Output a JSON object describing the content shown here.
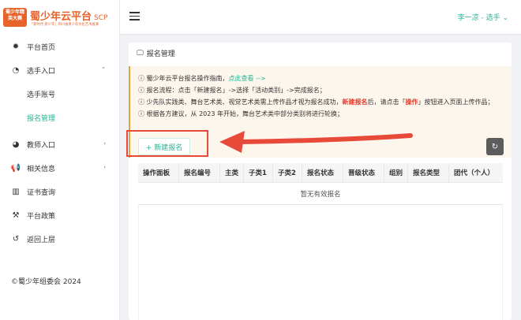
{
  "brand": {
    "badge": "蜀少年精英大赛",
    "title": "蜀少年云平台",
    "suffix": "SCP",
    "subtitle": "「新时代·新少年」四川省青少年文化艺术展演",
    "color": "#e8632a"
  },
  "sidebar": {
    "items": [
      {
        "label": "平台首页",
        "icon": "gear-icon"
      },
      {
        "label": "选手入口",
        "icon": "user-icon",
        "expanded": true
      },
      {
        "label": "教师入口",
        "icon": "teacher-icon"
      },
      {
        "label": "相关信息",
        "icon": "megaphone-icon"
      },
      {
        "label": "证书查询",
        "icon": "certificate-icon"
      },
      {
        "label": "平台政策",
        "icon": "hammer-icon"
      },
      {
        "label": "返回上层",
        "icon": "back-icon"
      }
    ],
    "sub_items": [
      {
        "label": "选手账号"
      },
      {
        "label": "报名管理",
        "active": true
      }
    ],
    "copyright": "©蜀少年组委会 2024"
  },
  "header": {
    "user": "李一凉 - 选手 ⌄"
  },
  "card": {
    "title": "报名管理",
    "notice": {
      "line1_text": "蜀少年云平台报名操作指南，",
      "line1_link": "点此查看 -->",
      "line2": "报名流程：点击「新建报名」->选择「活动类别」->完成报名；",
      "line3_a": "少先队实践类、舞台艺术类、视觉艺术类需上传作品才视为报名成功，",
      "line3_red1": "新建报名",
      "line3_b": "后，请点击「",
      "line3_red2": "操作",
      "line3_c": "」按钮进入页面上传作品；",
      "line4": "根据各方建议，从 2023 年开始，舞台艺术类中部分类别将进行轮换；"
    },
    "new_button": "+ 新建报名",
    "table": {
      "columns": [
        "操作面板",
        "报名编号",
        "主类",
        "子类1",
        "子类2",
        "报名状态",
        "晋级状态",
        "组别",
        "报名类型",
        "团代（个人）"
      ],
      "empty_text": "暂无有效报名"
    }
  },
  "colors": {
    "accent": "#29b396",
    "notice_bg": "#fdf6ec",
    "annotation": "#e84a3a"
  }
}
